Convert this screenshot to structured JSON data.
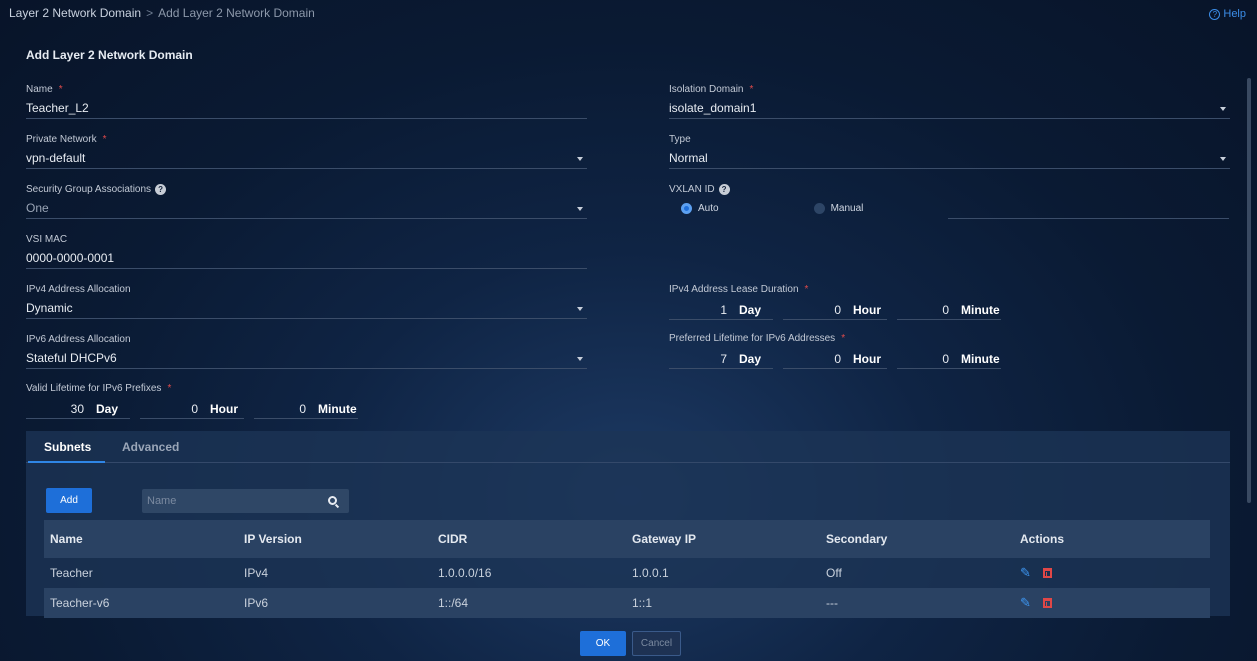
{
  "breadcrumb": {
    "parent": "Layer 2 Network Domain",
    "separator": ">",
    "current": "Add Layer 2 Network Domain"
  },
  "help": {
    "label": "Help"
  },
  "page_title": "Add Layer 2 Network Domain",
  "form": {
    "name": {
      "label": "Name",
      "value": "Teacher_L2"
    },
    "private_network": {
      "label": "Private Network",
      "value": "vpn-default"
    },
    "security_group": {
      "label": "Security Group Associations",
      "value": "One"
    },
    "vsi_mac": {
      "label": "VSI MAC",
      "value": "0000-0000-0001"
    },
    "ipv4_allocation": {
      "label": "IPv4 Address Allocation",
      "value": "Dynamic"
    },
    "ipv6_allocation": {
      "label": "IPv6 Address Allocation",
      "value": "Stateful DHCPv6"
    },
    "valid_lifetime": {
      "label": "Valid Lifetime for IPv6 Prefixes",
      "day": "30",
      "hour": "0",
      "minute": "0"
    },
    "isolation_domain": {
      "label": "Isolation Domain",
      "value": "isolate_domain1"
    },
    "type": {
      "label": "Type",
      "value": "Normal"
    },
    "vxlan_id": {
      "label": "VXLAN ID",
      "auto": "Auto",
      "manual": "Manual",
      "selected": "Auto"
    },
    "ipv4_lease": {
      "label": "IPv4 Address Lease Duration",
      "day": "1",
      "hour": "0",
      "minute": "0"
    },
    "preferred_lifetime": {
      "label": "Preferred Lifetime for IPv6 Addresses",
      "day": "7",
      "hour": "0",
      "minute": "0"
    },
    "units": {
      "day": "Day",
      "hour": "Hour",
      "minute": "Minute"
    }
  },
  "tabs": [
    {
      "label": "Subnets",
      "active": true
    },
    {
      "label": "Advanced",
      "active": false
    }
  ],
  "subnets": {
    "add_label": "Add",
    "search_placeholder": "Name",
    "columns": [
      "Name",
      "IP Version",
      "CIDR",
      "Gateway IP",
      "Secondary",
      "Actions"
    ],
    "rows": [
      {
        "name": "Teacher",
        "ip_version": "IPv4",
        "cidr": "1.0.0.0/16",
        "gateway": "1.0.0.1",
        "secondary": "Off"
      },
      {
        "name": "Teacher-v6",
        "ip_version": "IPv6",
        "cidr": "1::/64",
        "gateway": "1::1",
        "secondary": "---"
      }
    ]
  },
  "footer": {
    "ok_label": "OK",
    "cancel_label": "Cancel"
  },
  "colors": {
    "accent": "#1e6fd9",
    "required": "#e24b4b",
    "delete": "#e04747",
    "edit": "#3d95f0"
  }
}
